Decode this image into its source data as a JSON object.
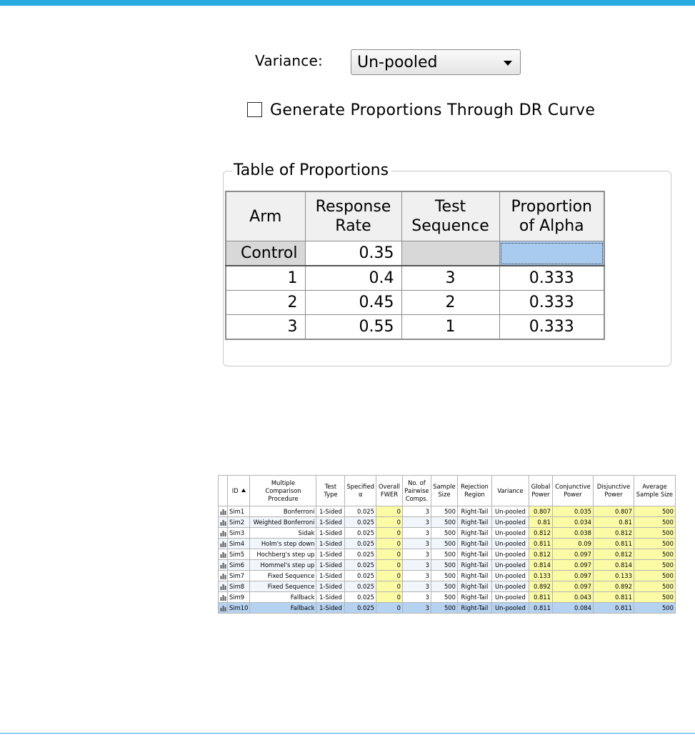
{
  "variance": {
    "label": "Variance:",
    "selected": "Un-pooled"
  },
  "dr_curve": {
    "label": "Generate Proportions Through DR Curve",
    "checked": false
  },
  "proportions": {
    "title": "Table of Proportions",
    "columns": [
      "Arm",
      "Response\nRate",
      "Test\nSequence",
      "Proportion\nof Alpha"
    ],
    "rows": [
      {
        "arm": "Control",
        "rate": "0.35",
        "seq": "",
        "alpha": ""
      },
      {
        "arm": "1",
        "rate": "0.4",
        "seq": "3",
        "alpha": "0.333"
      },
      {
        "arm": "2",
        "rate": "0.45",
        "seq": "2",
        "alpha": "0.333"
      },
      {
        "arm": "3",
        "rate": "0.55",
        "seq": "1",
        "alpha": "0.333"
      }
    ]
  },
  "results": {
    "columns": [
      "ID",
      "Multiple\nComparison\nProcedure",
      "Test\nType",
      "Specified\nα",
      "Overall\nFWER",
      "No. of\nPairwise\nComps.",
      "Sample\nSize",
      "Rejection\nRegion",
      "Variance",
      "Global\nPower",
      "Conjunctive\nPower",
      "Disjunctive\nPower",
      "Average\nSample Size"
    ],
    "rows": [
      [
        "Sim1",
        "Bonferroni",
        "1-Sided",
        "0.025",
        "0",
        "3",
        "500",
        "Right-Tail",
        "Un-pooled",
        "0.807",
        "0.035",
        "0.807",
        "500"
      ],
      [
        "Sim2",
        "Weighted Bonferroni",
        "1-Sided",
        "0.025",
        "0",
        "3",
        "500",
        "Right-Tail",
        "Un-pooled",
        "0.81",
        "0.034",
        "0.81",
        "500"
      ],
      [
        "Sim3",
        "Sidak",
        "1-Sided",
        "0.025",
        "0",
        "3",
        "500",
        "Right-Tail",
        "Un-pooled",
        "0.812",
        "0.038",
        "0.812",
        "500"
      ],
      [
        "Sim4",
        "Holm's step down",
        "1-Sided",
        "0.025",
        "0",
        "3",
        "500",
        "Right-Tail",
        "Un-pooled",
        "0.811",
        "0.09",
        "0.811",
        "500"
      ],
      [
        "Sim5",
        "Hochberg's step up",
        "1-Sided",
        "0.025",
        "0",
        "3",
        "500",
        "Right-Tail",
        "Un-pooled",
        "0.812",
        "0.097",
        "0.812",
        "500"
      ],
      [
        "Sim6",
        "Hommel's step up",
        "1-Sided",
        "0.025",
        "0",
        "3",
        "500",
        "Right-Tail",
        "Un-pooled",
        "0.814",
        "0.097",
        "0.814",
        "500"
      ],
      [
        "Sim7",
        "Fixed Sequence",
        "1-Sided",
        "0.025",
        "0",
        "3",
        "500",
        "Right-Tail",
        "Un-pooled",
        "0.133",
        "0.097",
        "0.133",
        "500"
      ],
      [
        "Sim8",
        "Fixed Sequence",
        "1-Sided",
        "0.025",
        "0",
        "3",
        "500",
        "Right-Tail",
        "Un-pooled",
        "0.892",
        "0.097",
        "0.892",
        "500"
      ],
      [
        "Sim9",
        "Fallback",
        "1-Sided",
        "0.025",
        "0",
        "3",
        "500",
        "Right-Tail",
        "Un-pooled",
        "0.811",
        "0.043",
        "0.811",
        "500"
      ],
      [
        "Sim10",
        "Fallback",
        "1-Sided",
        "0.025",
        "0",
        "3",
        "500",
        "Right-Tail",
        "Un-pooled",
        "0.811",
        "0.084",
        "0.811",
        "500"
      ]
    ],
    "selected_row": 9,
    "focused_row": 6,
    "row_icon": "bar-chart-icon"
  },
  "colors": {
    "accent": "#29abe2",
    "highlight_yellow": "#fbfba6",
    "selection_blue": "#b6d2f1"
  }
}
